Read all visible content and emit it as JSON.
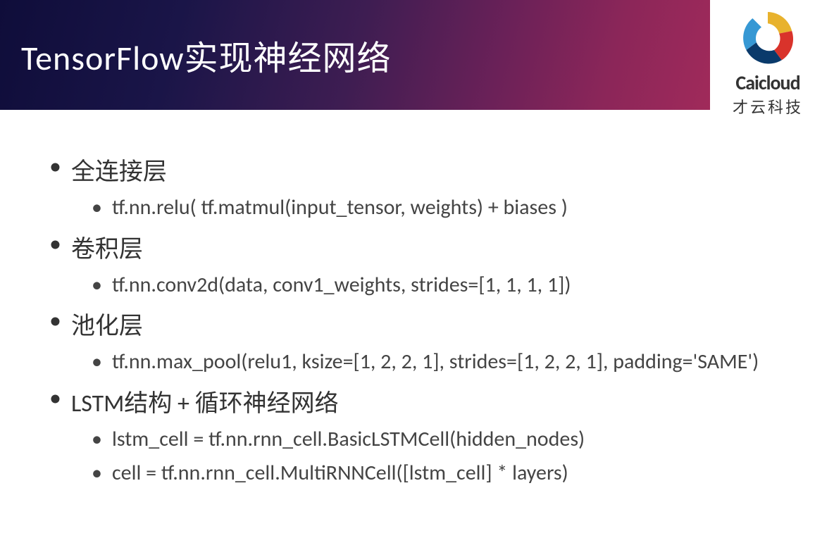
{
  "header": {
    "title": "TensorFlow实现神经网络"
  },
  "logo": {
    "brand_text": "Caicloud",
    "subtitle": "才云科技"
  },
  "content": {
    "items": [
      {
        "level": 1,
        "text": "全连接层"
      },
      {
        "level": 2,
        "text": "tf.nn.relu( tf.matmul(input_tensor, weights) + biases )"
      },
      {
        "level": 1,
        "text": "卷积层"
      },
      {
        "level": 2,
        "text": "tf.nn.conv2d(data, conv1_weights, strides=[1, 1, 1, 1])"
      },
      {
        "level": 1,
        "text": "池化层"
      },
      {
        "level": 2,
        "text": "tf.nn.max_pool(relu1, ksize=[1, 2, 2, 1], strides=[1, 2, 2, 1], padding='SAME')"
      },
      {
        "level": 1,
        "text": "LSTM结构 + 循环神经网络"
      },
      {
        "level": 2,
        "text": "lstm_cell = tf.nn.rnn_cell.BasicLSTMCell(hidden_nodes)"
      },
      {
        "level": 2,
        "text": "cell = tf.nn.rnn_cell.MultiRNNCell([lstm_cell] * layers)"
      }
    ]
  }
}
